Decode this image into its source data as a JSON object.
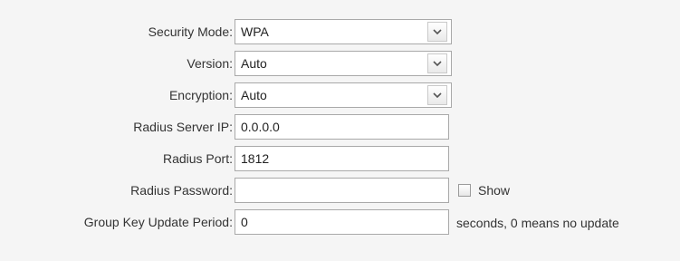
{
  "form": {
    "security_mode": {
      "label": "Security Mode:",
      "value": "WPA",
      "icon": "chevron-down-icon"
    },
    "version": {
      "label": "Version:",
      "value": "Auto",
      "icon": "chevron-down-icon"
    },
    "encryption": {
      "label": "Encryption:",
      "value": "Auto",
      "icon": "chevron-down-icon"
    },
    "radius_server_ip": {
      "label": "Radius Server IP:",
      "value": "0.0.0.0"
    },
    "radius_port": {
      "label": "Radius Port:",
      "value": "1812"
    },
    "radius_password": {
      "label": "Radius Password:",
      "value": "",
      "show_label": "Show"
    },
    "group_key_update_period": {
      "label": "Group Key Update Period:",
      "value": "0",
      "hint": "seconds, 0 means no update"
    }
  }
}
